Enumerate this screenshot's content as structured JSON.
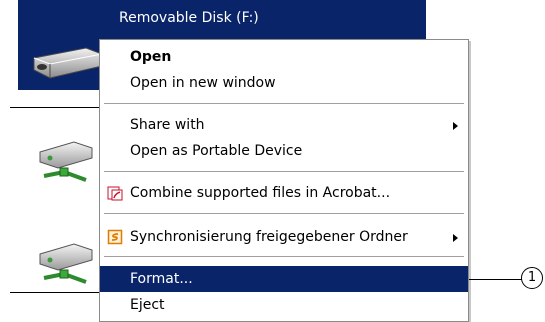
{
  "explorer": {
    "selected_drive_label": "Removable Disk (F:)",
    "drives": [
      {
        "icon": "removable-disk-icon"
      },
      {
        "icon": "network-drive-icon"
      },
      {
        "icon": "network-drive-icon"
      }
    ]
  },
  "context_menu": {
    "items": [
      {
        "label": "Open",
        "bold": true
      },
      {
        "label": "Open in new window"
      },
      {
        "label": "Share with",
        "submenu": true
      },
      {
        "label": "Open as Portable Device"
      },
      {
        "label": "Combine supported files in Acrobat...",
        "icon": "acrobat-icon"
      },
      {
        "label": "Synchronisierung freigegebener Ordner",
        "icon": "sync-icon",
        "submenu": true
      },
      {
        "label": "Format...",
        "highlighted": true
      },
      {
        "label": "Eject"
      }
    ]
  },
  "callout": {
    "number": "1"
  },
  "colors": {
    "selection": "#0a246a",
    "menu_border": "#8a8a8a",
    "acrobat_red": "#c8102e",
    "sync_orange": "#e07b00"
  }
}
